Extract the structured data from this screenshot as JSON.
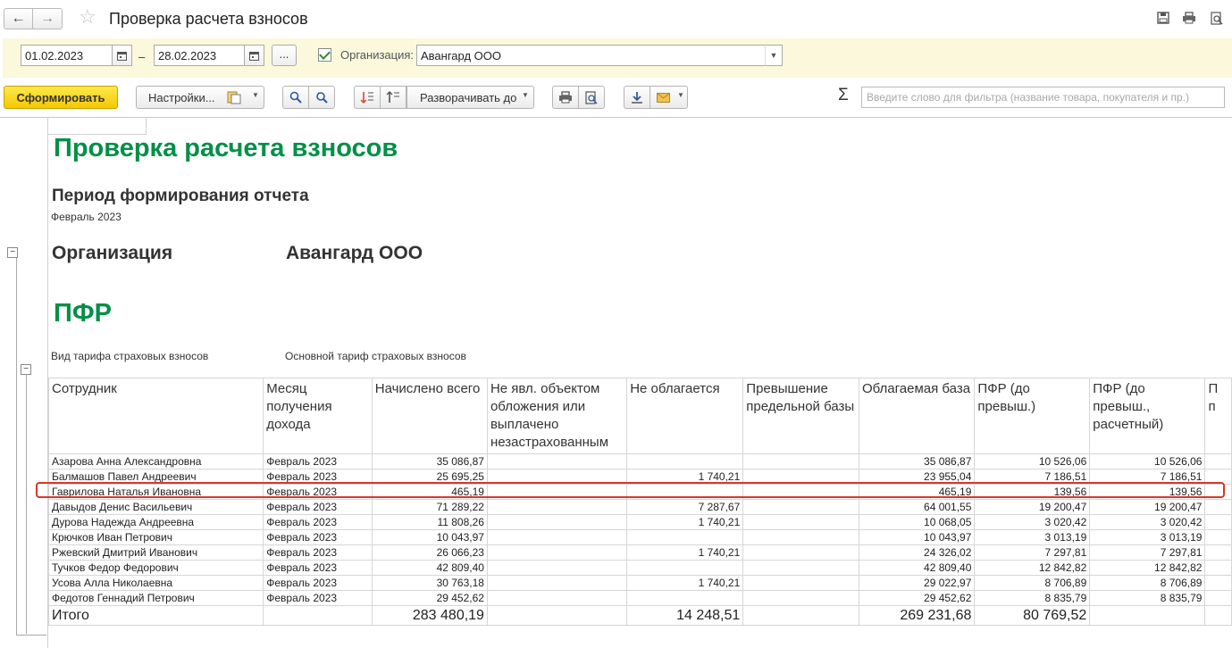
{
  "window": {
    "title": "Проверка расчета взносов"
  },
  "params": {
    "date_from": "01.02.2023",
    "date_to": "28.02.2023",
    "dash": "–",
    "dots": "...",
    "org_label": "Организация:",
    "org_value": "Авангард ООО"
  },
  "toolbar": {
    "generate": "Сформировать",
    "settings": "Настройки...",
    "expand": "Разворачивать до",
    "sigma": "Σ",
    "filter_placeholder": "Введите слово для фильтра (название товара, покупателя и пр.)"
  },
  "report": {
    "title": "Проверка расчета взносов",
    "period_heading": "Период формирования отчета",
    "period_value": "Февраль 2023",
    "org_heading": "Организация",
    "org_value": "Авангард ООО",
    "section": "ПФР",
    "tariff_label": "Вид тарифа страховых взносов",
    "tariff_value": "Основной тариф страховых взносов"
  },
  "table": {
    "headers": [
      "Сотрудник",
      "Месяц получения дохода",
      "Начислено всего",
      "Не явл. объектом обложения или выплачено незастрахованным",
      "Не облагается",
      "Превышение предельной базы",
      "Облагаемая база",
      "ПФР (до превыш.)",
      "ПФР (до превыш., расчетный)",
      "П п"
    ],
    "rows": [
      [
        "Азарова Анна Александровна",
        "Февраль 2023",
        "35 086,87",
        "",
        "",
        "",
        "35 086,87",
        "10 526,06",
        "10 526,06",
        ""
      ],
      [
        "Балмашов Павел Андреевич",
        "Февраль 2023",
        "25 695,25",
        "",
        "1 740,21",
        "",
        "23 955,04",
        "7 186,51",
        "7 186,51",
        ""
      ],
      [
        "Гаврилова Наталья Ивановна",
        "Февраль 2023",
        "465,19",
        "",
        "",
        "",
        "465,19",
        "139,56",
        "139,56",
        ""
      ],
      [
        "Давыдов Денис Васильевич",
        "Февраль 2023",
        "71 289,22",
        "",
        "7 287,67",
        "",
        "64 001,55",
        "19 200,47",
        "19 200,47",
        ""
      ],
      [
        "Дурова Надежда Андреевна",
        "Февраль 2023",
        "11 808,26",
        "",
        "1 740,21",
        "",
        "10 068,05",
        "3 020,42",
        "3 020,42",
        ""
      ],
      [
        "Крючков Иван Петрович",
        "Февраль 2023",
        "10 043,97",
        "",
        "",
        "",
        "10 043,97",
        "3 013,19",
        "3 013,19",
        ""
      ],
      [
        "Ржевский Дмитрий Иванович",
        "Февраль 2023",
        "26 066,23",
        "",
        "1 740,21",
        "",
        "24 326,02",
        "7 297,81",
        "7 297,81",
        ""
      ],
      [
        "Тучков Федор Федорович",
        "Февраль 2023",
        "42 809,40",
        "",
        "",
        "",
        "42 809,40",
        "12 842,82",
        "12 842,82",
        ""
      ],
      [
        "Усова Алла Николаевна",
        "Февраль 2023",
        "30 763,18",
        "",
        "1 740,21",
        "",
        "29 022,97",
        "8 706,89",
        "8 706,89",
        ""
      ],
      [
        "Федотов Геннадий Петрович",
        "Февраль 2023",
        "29 452,62",
        "",
        "",
        "",
        "29 452,62",
        "8 835,79",
        "8 835,79",
        ""
      ]
    ],
    "total": [
      "Итого",
      "",
      "283 480,19",
      "",
      "14 248,51",
      "",
      "269 231,68",
      "80 769,52",
      "",
      ""
    ],
    "highlighted_row": "Гаврилова Наталья Ивановна"
  }
}
